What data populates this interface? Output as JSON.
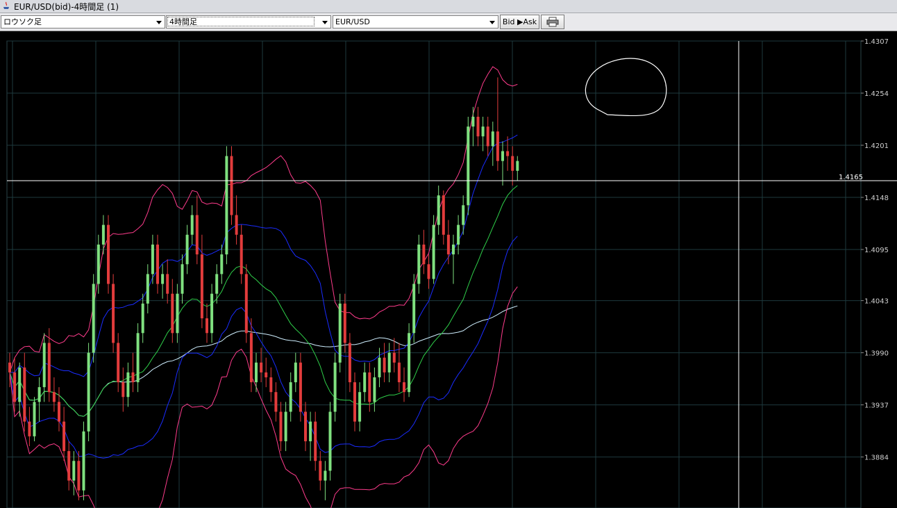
{
  "window": {
    "title": "EUR/USD(bid)-4時間足 (1)"
  },
  "toolbar": {
    "chart_type": "ロウソク足",
    "timeframe": "4時間足",
    "symbol": "EUR/USD",
    "bid_ask_label": "Bid ▶Ask",
    "print_icon": "printer-icon"
  },
  "chart_data": {
    "type": "candlestick",
    "symbol": "EUR/USD",
    "timeframe": "4時間足",
    "y_ticks": [
      "1.4307",
      "1.4254",
      "1.4201",
      "1.4148",
      "1.4095",
      "1.4043",
      "1.3990",
      "1.3937",
      "1.3884"
    ],
    "ylim": [
      1.3833,
      1.4307
    ],
    "current_price": "1.4165",
    "colors": {
      "up": "#7fe07f",
      "down": "#e23c3c",
      "bollinger_outer": "#ff3c8c",
      "bollinger_inner": "#1a2cff",
      "ma_mid": "#2fd04a",
      "ma_long": "#cfefff",
      "grid": "#1e3a3e",
      "price_line": "#ffffff"
    },
    "candles": [
      {
        "o": 1.398,
        "h": 1.399,
        "l": 1.3955,
        "c": 1.397
      },
      {
        "o": 1.397,
        "h": 1.3985,
        "l": 1.393,
        "c": 1.394
      },
      {
        "o": 1.394,
        "h": 1.398,
        "l": 1.3925,
        "c": 1.3975
      },
      {
        "o": 1.3975,
        "h": 1.399,
        "l": 1.391,
        "c": 1.392
      },
      {
        "o": 1.392,
        "h": 1.3935,
        "l": 1.3895,
        "c": 1.3905
      },
      {
        "o": 1.3905,
        "h": 1.3945,
        "l": 1.39,
        "c": 1.394
      },
      {
        "o": 1.394,
        "h": 1.3965,
        "l": 1.392,
        "c": 1.3955
      },
      {
        "o": 1.3955,
        "h": 1.401,
        "l": 1.394,
        "c": 1.4
      },
      {
        "o": 1.4,
        "h": 1.4015,
        "l": 1.394,
        "c": 1.395
      },
      {
        "o": 1.395,
        "h": 1.3965,
        "l": 1.393,
        "c": 1.394
      },
      {
        "o": 1.394,
        "h": 1.3955,
        "l": 1.391,
        "c": 1.392
      },
      {
        "o": 1.392,
        "h": 1.3935,
        "l": 1.388,
        "c": 1.389
      },
      {
        "o": 1.389,
        "h": 1.39,
        "l": 1.385,
        "c": 1.386
      },
      {
        "o": 1.386,
        "h": 1.389,
        "l": 1.3845,
        "c": 1.388
      },
      {
        "o": 1.388,
        "h": 1.389,
        "l": 1.384,
        "c": 1.385
      },
      {
        "o": 1.385,
        "h": 1.392,
        "l": 1.384,
        "c": 1.391
      },
      {
        "o": 1.391,
        "h": 1.4,
        "l": 1.39,
        "c": 1.399
      },
      {
        "o": 1.399,
        "h": 1.407,
        "l": 1.398,
        "c": 1.406
      },
      {
        "o": 1.406,
        "h": 1.411,
        "l": 1.405,
        "c": 1.41
      },
      {
        "o": 1.41,
        "h": 1.413,
        "l": 1.409,
        "c": 1.412
      },
      {
        "o": 1.412,
        "h": 1.413,
        "l": 1.405,
        "c": 1.406
      },
      {
        "o": 1.406,
        "h": 1.407,
        "l": 1.399,
        "c": 1.4
      },
      {
        "o": 1.4,
        "h": 1.401,
        "l": 1.395,
        "c": 1.396
      },
      {
        "o": 1.396,
        "h": 1.3975,
        "l": 1.393,
        "c": 1.3945
      },
      {
        "o": 1.3945,
        "h": 1.398,
        "l": 1.3935,
        "c": 1.397
      },
      {
        "o": 1.397,
        "h": 1.399,
        "l": 1.395,
        "c": 1.396
      },
      {
        "o": 1.396,
        "h": 1.402,
        "l": 1.395,
        "c": 1.401
      },
      {
        "o": 1.401,
        "h": 1.405,
        "l": 1.4,
        "c": 1.404
      },
      {
        "o": 1.404,
        "h": 1.408,
        "l": 1.403,
        "c": 1.407
      },
      {
        "o": 1.407,
        "h": 1.411,
        "l": 1.406,
        "c": 1.41
      },
      {
        "o": 1.41,
        "h": 1.411,
        "l": 1.405,
        "c": 1.406
      },
      {
        "o": 1.406,
        "h": 1.408,
        "l": 1.4045,
        "c": 1.407
      },
      {
        "o": 1.407,
        "h": 1.4085,
        "l": 1.404,
        "c": 1.405
      },
      {
        "o": 1.405,
        "h": 1.4065,
        "l": 1.4,
        "c": 1.401
      },
      {
        "o": 1.401,
        "h": 1.406,
        "l": 1.4,
        "c": 1.405
      },
      {
        "o": 1.405,
        "h": 1.409,
        "l": 1.404,
        "c": 1.408
      },
      {
        "o": 1.408,
        "h": 1.412,
        "l": 1.407,
        "c": 1.411
      },
      {
        "o": 1.411,
        "h": 1.414,
        "l": 1.41,
        "c": 1.413
      },
      {
        "o": 1.413,
        "h": 1.415,
        "l": 1.408,
        "c": 1.409
      },
      {
        "o": 1.409,
        "h": 1.411,
        "l": 1.4015,
        "c": 1.4025
      },
      {
        "o": 1.4025,
        "h": 1.404,
        "l": 1.4,
        "c": 1.401
      },
      {
        "o": 1.401,
        "h": 1.406,
        "l": 1.4,
        "c": 1.405
      },
      {
        "o": 1.405,
        "h": 1.408,
        "l": 1.404,
        "c": 1.407
      },
      {
        "o": 1.407,
        "h": 1.41,
        "l": 1.406,
        "c": 1.409
      },
      {
        "o": 1.409,
        "h": 1.42,
        "l": 1.408,
        "c": 1.419
      },
      {
        "o": 1.419,
        "h": 1.42,
        "l": 1.412,
        "c": 1.413
      },
      {
        "o": 1.413,
        "h": 1.415,
        "l": 1.41,
        "c": 1.411
      },
      {
        "o": 1.411,
        "h": 1.412,
        "l": 1.406,
        "c": 1.407
      },
      {
        "o": 1.407,
        "h": 1.408,
        "l": 1.4,
        "c": 1.401
      },
      {
        "o": 1.401,
        "h": 1.4025,
        "l": 1.395,
        "c": 1.396
      },
      {
        "o": 1.396,
        "h": 1.399,
        "l": 1.395,
        "c": 1.398
      },
      {
        "o": 1.398,
        "h": 1.3995,
        "l": 1.396,
        "c": 1.397
      },
      {
        "o": 1.397,
        "h": 1.3985,
        "l": 1.3955,
        "c": 1.3965
      },
      {
        "o": 1.3965,
        "h": 1.3975,
        "l": 1.394,
        "c": 1.395
      },
      {
        "o": 1.395,
        "h": 1.396,
        "l": 1.392,
        "c": 1.393
      },
      {
        "o": 1.393,
        "h": 1.394,
        "l": 1.389,
        "c": 1.39
      },
      {
        "o": 1.39,
        "h": 1.394,
        "l": 1.389,
        "c": 1.393
      },
      {
        "o": 1.393,
        "h": 1.397,
        "l": 1.392,
        "c": 1.396
      },
      {
        "o": 1.396,
        "h": 1.399,
        "l": 1.395,
        "c": 1.398
      },
      {
        "o": 1.398,
        "h": 1.399,
        "l": 1.392,
        "c": 1.393
      },
      {
        "o": 1.393,
        "h": 1.394,
        "l": 1.389,
        "c": 1.39
      },
      {
        "o": 1.39,
        "h": 1.393,
        "l": 1.388,
        "c": 1.392
      },
      {
        "o": 1.392,
        "h": 1.393,
        "l": 1.387,
        "c": 1.388
      },
      {
        "o": 1.388,
        "h": 1.389,
        "l": 1.385,
        "c": 1.386
      },
      {
        "o": 1.386,
        "h": 1.388,
        "l": 1.384,
        "c": 1.387
      },
      {
        "o": 1.387,
        "h": 1.394,
        "l": 1.386,
        "c": 1.393
      },
      {
        "o": 1.393,
        "h": 1.399,
        "l": 1.392,
        "c": 1.398
      },
      {
        "o": 1.398,
        "h": 1.405,
        "l": 1.397,
        "c": 1.404
      },
      {
        "o": 1.404,
        "h": 1.405,
        "l": 1.399,
        "c": 1.4
      },
      {
        "o": 1.4,
        "h": 1.401,
        "l": 1.395,
        "c": 1.396
      },
      {
        "o": 1.396,
        "h": 1.397,
        "l": 1.391,
        "c": 1.392
      },
      {
        "o": 1.392,
        "h": 1.396,
        "l": 1.391,
        "c": 1.395
      },
      {
        "o": 1.395,
        "h": 1.398,
        "l": 1.394,
        "c": 1.397
      },
      {
        "o": 1.397,
        "h": 1.398,
        "l": 1.393,
        "c": 1.394
      },
      {
        "o": 1.394,
        "h": 1.3975,
        "l": 1.393,
        "c": 1.3965
      },
      {
        "o": 1.3965,
        "h": 1.3995,
        "l": 1.3955,
        "c": 1.3985
      },
      {
        "o": 1.3985,
        "h": 1.4,
        "l": 1.396,
        "c": 1.397
      },
      {
        "o": 1.397,
        "h": 1.4,
        "l": 1.396,
        "c": 1.399
      },
      {
        "o": 1.399,
        "h": 1.4005,
        "l": 1.397,
        "c": 1.398
      },
      {
        "o": 1.398,
        "h": 1.4,
        "l": 1.395,
        "c": 1.396
      },
      {
        "o": 1.396,
        "h": 1.3975,
        "l": 1.394,
        "c": 1.395
      },
      {
        "o": 1.395,
        "h": 1.402,
        "l": 1.3945,
        "c": 1.401
      },
      {
        "o": 1.401,
        "h": 1.407,
        "l": 1.4,
        "c": 1.406
      },
      {
        "o": 1.406,
        "h": 1.411,
        "l": 1.405,
        "c": 1.41
      },
      {
        "o": 1.41,
        "h": 1.4115,
        "l": 1.407,
        "c": 1.408
      },
      {
        "o": 1.408,
        "h": 1.409,
        "l": 1.4055,
        "c": 1.4065
      },
      {
        "o": 1.4065,
        "h": 1.413,
        "l": 1.406,
        "c": 1.412
      },
      {
        "o": 1.412,
        "h": 1.416,
        "l": 1.411,
        "c": 1.415
      },
      {
        "o": 1.415,
        "h": 1.4155,
        "l": 1.41,
        "c": 1.411
      },
      {
        "o": 1.411,
        "h": 1.4125,
        "l": 1.408,
        "c": 1.409
      },
      {
        "o": 1.409,
        "h": 1.411,
        "l": 1.406,
        "c": 1.41
      },
      {
        "o": 1.41,
        "h": 1.413,
        "l": 1.409,
        "c": 1.412
      },
      {
        "o": 1.412,
        "h": 1.415,
        "l": 1.411,
        "c": 1.414
      },
      {
        "o": 1.414,
        "h": 1.423,
        "l": 1.413,
        "c": 1.422
      },
      {
        "o": 1.422,
        "h": 1.424,
        "l": 1.42,
        "c": 1.423
      },
      {
        "o": 1.423,
        "h": 1.424,
        "l": 1.42,
        "c": 1.421
      },
      {
        "o": 1.421,
        "h": 1.423,
        "l": 1.4195,
        "c": 1.422
      },
      {
        "o": 1.422,
        "h": 1.423,
        "l": 1.419,
        "c": 1.42
      },
      {
        "o": 1.42,
        "h": 1.4225,
        "l": 1.418,
        "c": 1.4215
      },
      {
        "o": 1.4215,
        "h": 1.427,
        "l": 1.4175,
        "c": 1.4185
      },
      {
        "o": 1.4185,
        "h": 1.4205,
        "l": 1.416,
        "c": 1.4195
      },
      {
        "o": 1.4195,
        "h": 1.421,
        "l": 1.4175,
        "c": 1.419
      },
      {
        "o": 1.419,
        "h": 1.42,
        "l": 1.416,
        "c": 1.4175
      },
      {
        "o": 1.4175,
        "h": 1.419,
        "l": 1.4165,
        "c": 1.4185
      }
    ]
  }
}
